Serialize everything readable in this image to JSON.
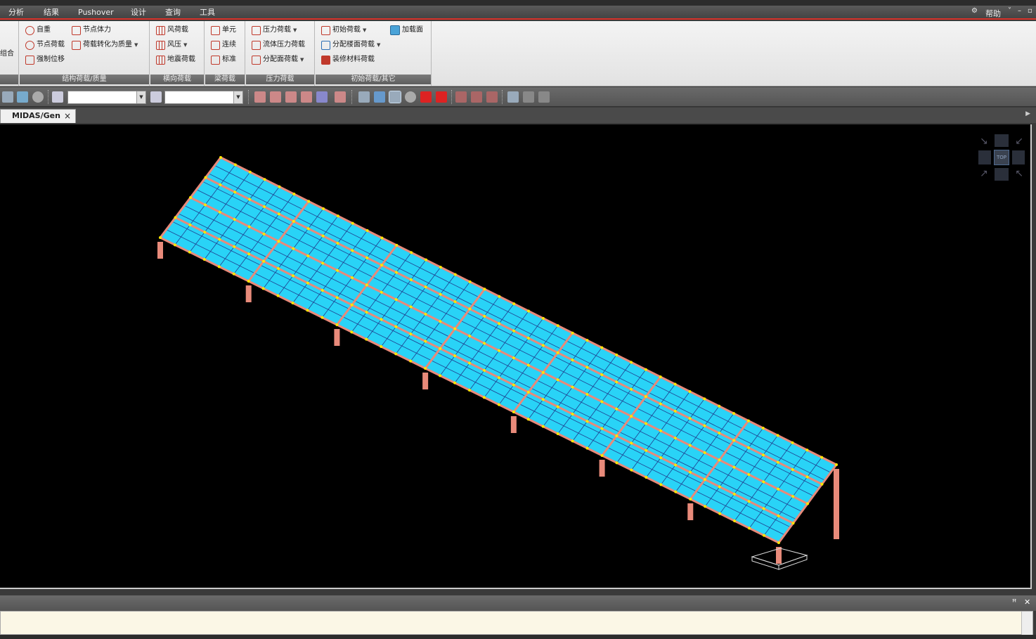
{
  "menu": {
    "items": [
      "分析",
      "结果",
      "Pushover",
      "设计",
      "查询",
      "工具"
    ],
    "help": "帮助"
  },
  "ribbon": {
    "left_stub": "组合",
    "groups": [
      {
        "caption": "结构荷载/质量",
        "buttons": [
          "自重",
          "节点体力",
          "节点荷载",
          "荷载转化为质量",
          "强制位移"
        ]
      },
      {
        "caption": "横向荷载",
        "buttons": [
          "风荷载",
          "风压",
          "地震荷载"
        ]
      },
      {
        "caption": "梁荷载",
        "buttons": [
          "单元",
          "连续",
          "标准"
        ]
      },
      {
        "caption": "压力荷载",
        "buttons": [
          "压力荷载",
          "流体压力荷载",
          "分配面荷载"
        ]
      },
      {
        "caption": "初始荷载/其它",
        "buttons": [
          "初始荷载",
          "加载面",
          "分配楼面荷载",
          "装修材料荷载"
        ]
      }
    ]
  },
  "toolbar": {
    "combo1_value": "",
    "combo2_value": ""
  },
  "document_tab": {
    "label": "MIDAS/Gen",
    "close": "×"
  },
  "view_cube": {
    "label": "TOP"
  },
  "model": {
    "bays": 7,
    "panel_color": "#29d3f7",
    "mesh_color": "#1f3e8f",
    "member_color": "#e88a7a",
    "node_color": "#ffe600"
  },
  "output_panel": {
    "pin": "ꟸ",
    "close": "✕"
  }
}
